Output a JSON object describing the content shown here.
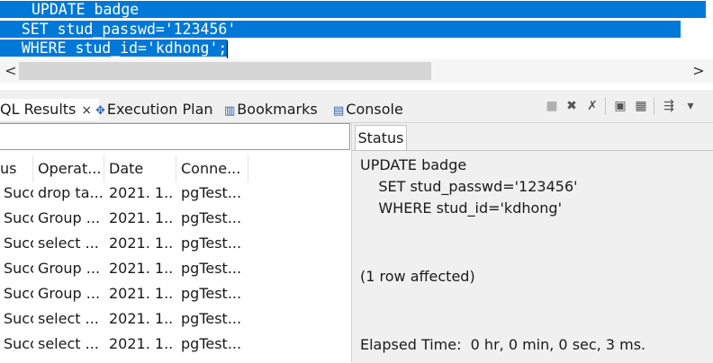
{
  "editor": {
    "lines": [
      "UPDATE badge",
      "  SET stud_passwd='123456'",
      "  WHERE stud_id='kdhong';"
    ]
  },
  "scrollbar": {
    "left_arrow": "<",
    "right_arrow": ">"
  },
  "tabs": {
    "results": "QL Results",
    "results_close": "×",
    "plan": "Execution Plan",
    "bookmarks": "Bookmarks",
    "console": "Console"
  },
  "results_table": {
    "columns": [
      "us",
      "Operat...",
      "Date",
      "Conne..."
    ],
    "rows": [
      [
        "Succ",
        "drop ta...",
        "2021. 1...",
        "pgTest..."
      ],
      [
        "Succ",
        "Group ...",
        "2021. 1...",
        "pgTest..."
      ],
      [
        "Succ",
        "select ...",
        "2021. 1...",
        "pgTest..."
      ],
      [
        "Succ",
        "Group ...",
        "2021. 1...",
        "pgTest..."
      ],
      [
        "Succ",
        "Group ...",
        "2021. 1...",
        "pgTest..."
      ],
      [
        "Succ",
        "select ...",
        "2021. 1...",
        "pgTest..."
      ],
      [
        "Succ",
        "select ...",
        "2021. 1...",
        "pgTest..."
      ]
    ]
  },
  "status_panel": {
    "tab_label": "Status",
    "query_lines": [
      "UPDATE badge",
      "    SET stud_passwd='123456'",
      "    WHERE stud_id='kdhong'"
    ],
    "affected": "(1 row affected)",
    "elapsed": "Elapsed Time:  0 hr, 0 min, 0 sec, 3 ms."
  },
  "toolbar_icons": [
    "stop-icon",
    "remove-icon",
    "remove-all-icon",
    "copy-icon",
    "paste-icon",
    "pin-icon",
    "view-menu-icon"
  ],
  "colors": {
    "selection": "#0078d7",
    "panel_bg": "#f0f0f0"
  }
}
